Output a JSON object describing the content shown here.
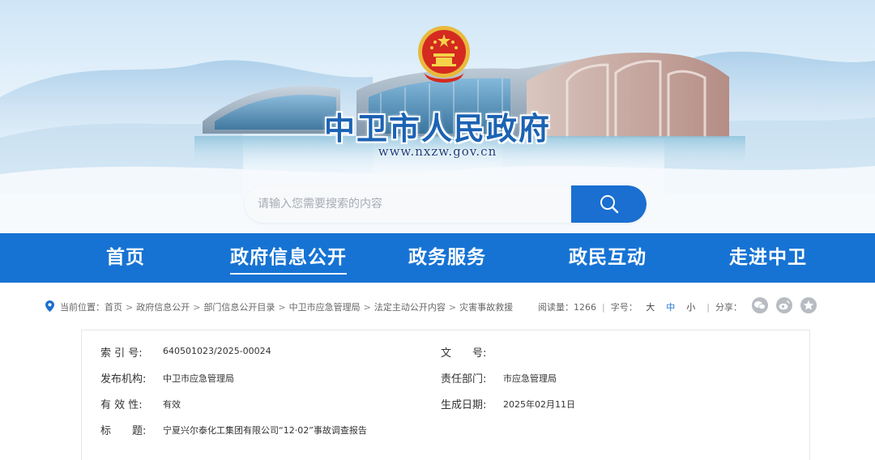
{
  "site": {
    "title": "中卫市人民政府",
    "url": "www.nxzw.gov.cn"
  },
  "search": {
    "placeholder": "请输入您需要搜索的内容",
    "button_icon": "search-icon"
  },
  "nav": {
    "items": [
      {
        "label": "首页"
      },
      {
        "label": "政府信息公开",
        "active": true
      },
      {
        "label": "政务服务"
      },
      {
        "label": "政民互动"
      },
      {
        "label": "走进中卫"
      }
    ]
  },
  "breadcrumb": {
    "prefix": "当前位置：",
    "items": [
      "首页",
      "政府信息公开",
      "部门信息公开目录",
      "中卫市应急管理局",
      "法定主动公开内容",
      "灾害事故救援"
    ],
    "separator": ">"
  },
  "tools": {
    "views_label": "阅读量：",
    "views": "1266",
    "fontsize_label": "字号：",
    "fontsize_options": [
      "大",
      "中",
      "小"
    ],
    "fontsize_selected": "中",
    "share_label": "分享：",
    "share_icons": [
      "wechat-icon",
      "weibo-icon",
      "star-icon"
    ]
  },
  "info": {
    "index_label": "索 引 号:",
    "index_value": "640501023/2025-00024",
    "docno_label": "文　　号:",
    "docno_value": "",
    "publisher_label": "发布机构:",
    "publisher_value": "中卫市应急管理局",
    "dept_label": "责任部门:",
    "dept_value": "市应急管理局",
    "validity_label": "有 效 性:",
    "validity_value": "有效",
    "date_label": "生成日期:",
    "date_value": "2025年02月11日",
    "title_label": "标　　题:",
    "title_value": "宁夏兴尔泰化工集团有限公司“12·02”事故调查报告"
  },
  "colors": {
    "brand_blue": "#1673d4",
    "title_blue": "#1c63b4",
    "active_font": "#1a6fd0"
  }
}
